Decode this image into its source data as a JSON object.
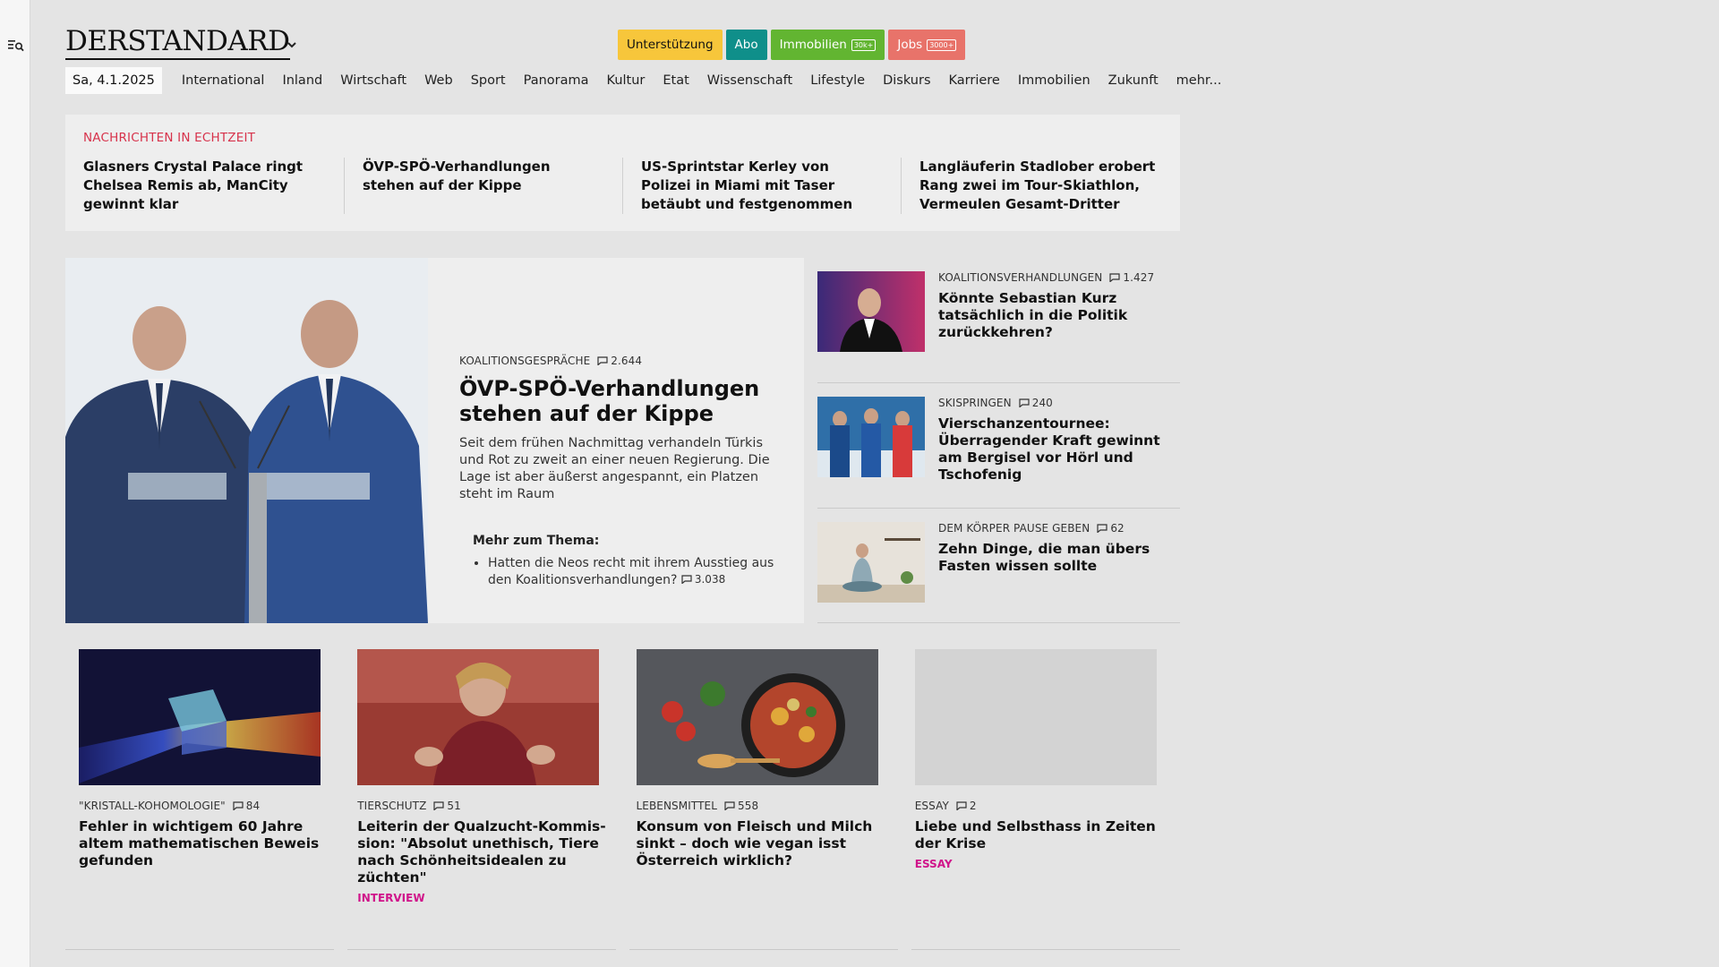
{
  "brand": {
    "logo": "derStandard"
  },
  "top_buttons": {
    "support": "Unterstützung",
    "abo": "Abo",
    "immobilien": "Immobilien",
    "immobilien_badge": "30k+",
    "jobs": "Jobs",
    "jobs_badge": "3000+"
  },
  "nav": {
    "date": "Sa, 4.1.2025",
    "items": [
      "International",
      "Inland",
      "Wirtschaft",
      "Web",
      "Sport",
      "Panorama",
      "Kultur",
      "Etat",
      "Wissenschaft",
      "Lifestyle",
      "Diskurs",
      "Karriere",
      "Immobilien",
      "Zukunft",
      "mehr..."
    ]
  },
  "ticker": {
    "heading": "Nachrichten in Echtzeit",
    "items": [
      "Glasners Crystal Palace ringt Chelsea Remis ab, ManCity gewinnt klar",
      "ÖVP-SPÖ-Verhandlungen stehen auf der Kippe",
      "US-Sprintstar Kerley von Polizei in Miami mit Taser betäubt und festgenommen",
      "Langläuferin Stadlober erobert Rang zwei im Tour-Skiathlon, Vermeulen Gesamt-Dritter"
    ]
  },
  "lead": {
    "kicker": "Koalitionsgespräche",
    "comments": "2.644",
    "title": "ÖVP-SPÖ-Verhandlungen stehen auf der Kippe",
    "teaser": "Seit dem frühen Nachmittag verhandeln Türkis und Rot zu zweit an einer neuen Regierung. Die Lage ist aber äußerst angespannt, ein Platzen steht im Raum",
    "more_heading": "Mehr zum Thema:",
    "more_item": "Hatten die Neos recht mit ihrem Ausstieg aus den Koalitionsverhandlungen?",
    "more_comments": "3.038"
  },
  "side": [
    {
      "kicker": "Koalitionsverhandlungen",
      "comments": "1.427",
      "title": "Könnte Sebastian Kurz tatsächlich in die Politik zurückkehren?"
    },
    {
      "kicker": "Skispringen",
      "comments": "240",
      "title": "Vierschanzentournee: Überragender Kraft gewinnt am Bergisel vor Hörl und Tschofenig"
    },
    {
      "kicker": "Dem Körper Pause geben",
      "comments": "62",
      "title": "Zehn Dinge, die man übers Fasten wissen sollte"
    }
  ],
  "cards": [
    {
      "kicker": "\"Kristall-Kohomologie\"",
      "comments": "84",
      "title": "Fehler in wichtigem 60 Jahre altem mathematischen Beweis gefunden",
      "tag": ""
    },
    {
      "kicker": "Tierschutz",
      "comments": "51",
      "title": "Leiterin der Qualzucht-Kommis­sion: \"Absolut unethisch, Tiere nach Schönheitsidealen zu züchten\"",
      "tag": "Interview"
    },
    {
      "kicker": "Lebensmittel",
      "comments": "558",
      "title": "Konsum von Fleisch und Milch sinkt – doch wie vegan isst Österreich wirklich?",
      "tag": ""
    },
    {
      "kicker": "Essay",
      "comments": "2",
      "title": "Liebe und Selbsthass in Zeiten der Krise",
      "tag": "Essay"
    }
  ],
  "colors": {
    "ticker_heading": "#d7324b",
    "tag": "#d0148a",
    "support": "#f7c63b",
    "abo": "#0f8f8a",
    "immobilien": "#62b531",
    "jobs": "#e8736a"
  },
  "icons": {
    "rail": "search-menu-icon",
    "logo_menu": "chevron-down-icon",
    "comments": "comment-icon"
  }
}
